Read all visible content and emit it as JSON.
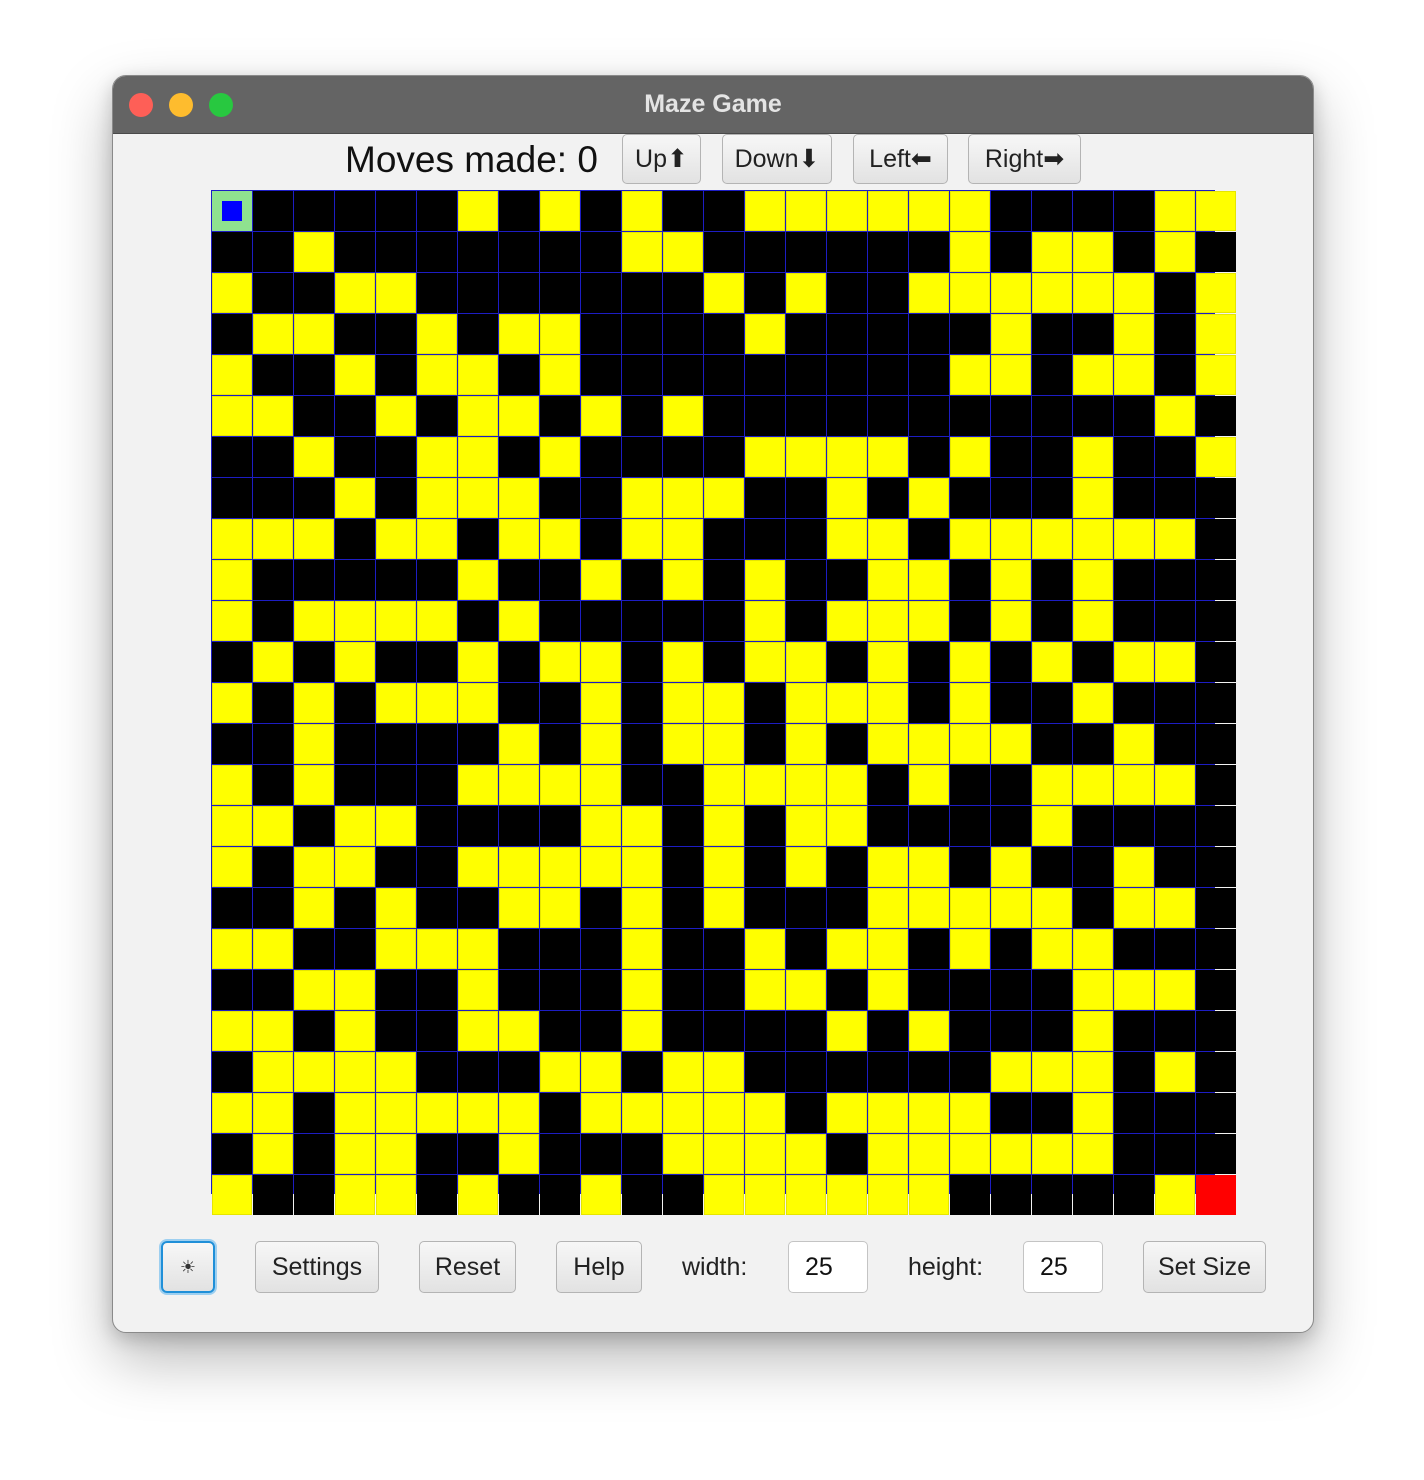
{
  "window": {
    "title": "Maze Game"
  },
  "status": {
    "moves_label": "Moves made: 0"
  },
  "controls": {
    "up": "Up⬆",
    "down": "Down⬇",
    "left": "Left⬅",
    "right": "Right➡"
  },
  "bottom": {
    "theme_icon": "☀",
    "settings": "Settings",
    "reset": "Reset",
    "help": "Help",
    "width_label": "width:",
    "width_value": "25",
    "height_label": "height:",
    "height_value": "25",
    "set_size": "Set Size"
  },
  "maze": {
    "cols": 25,
    "rows": 25,
    "legend": {
      "S": "start cell with player",
      "E": "exit cell",
      "0": "wall",
      "1": "open path"
    },
    "colors": {
      "wall": "#000000",
      "path": "#ffff00",
      "start": "#8fe28f",
      "player": "#0000ff",
      "end": "#ff0000",
      "grid": "#1d1dc4"
    },
    "grid": [
      "S000001010100111111000011",
      "0010000000110000001011010",
      "1001100000001010011111101",
      "0110010110000100000100101",
      "1001011010000000001101101",
      "1100101101010000000000010",
      "0010011010000111101001001",
      "0001011100111001010001000",
      "1110110110110001101111110",
      "1000001001010100110101000",
      "1011110100000101110101000",
      "0101001011010110101010110",
      "1010111001011011101001000",
      "0010000101011010111100100",
      "1010001111001111010011110",
      "1101100001101011000010000",
      "1011001111101010110100100",
      "0010100110101000111110110",
      "1100111000100101101011000",
      "0011001000100110100001110",
      "1101001100100001010001000",
      "0111100011011000000111010",
      "1101111101111101111001000",
      "0101100100011110111111000",
      "100110100100111111000001E"
    ]
  }
}
